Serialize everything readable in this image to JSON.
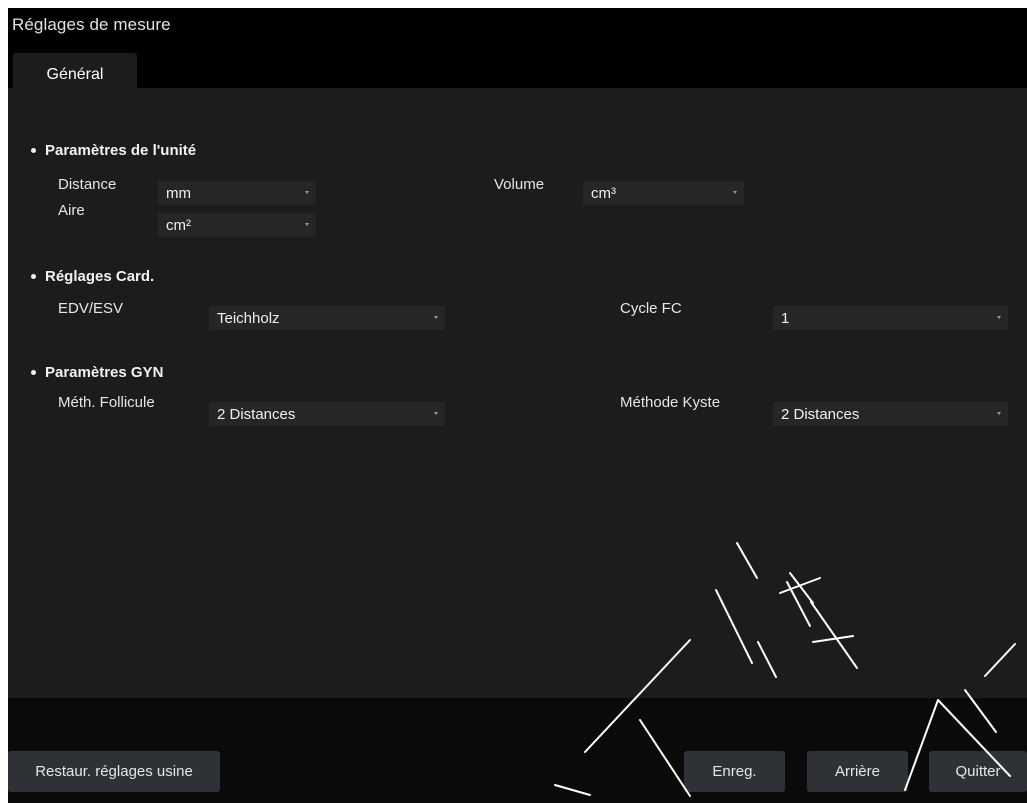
{
  "window": {
    "title": "Réglages de mesure"
  },
  "tabs": [
    {
      "label": "Général",
      "selected": true
    }
  ],
  "sections": {
    "units": {
      "heading": "Paramètres de l'unité",
      "distance": {
        "label": "Distance",
        "value": "mm"
      },
      "area": {
        "label": "Aire",
        "value": "cm²"
      },
      "volume": {
        "label": "Volume",
        "value": "cm³"
      }
    },
    "cardiac": {
      "heading": "Réglages Card.",
      "edv_esv": {
        "label": "EDV/ESV",
        "value": "Teichholz"
      },
      "hr_cycle": {
        "label": "Cycle FC",
        "value": "1"
      }
    },
    "gyn": {
      "heading": "Paramètres GYN",
      "follicle_method": {
        "label": "Méth. Follicule",
        "value": "2 Distances"
      },
      "cyst_method": {
        "label": "Méthode Kyste",
        "value": "2 Distances"
      }
    }
  },
  "buttons": {
    "restore_defaults": "Restaur. réglages usine",
    "save": "Enreg.",
    "back": "Arrière",
    "quit": "Quitter"
  },
  "icons": {
    "bullet": "bullet-icon",
    "dropdown_caret": "chevron-down-icon"
  },
  "colors": {
    "background": "#000000",
    "panel": "#1c1c1e",
    "dropdown": "#262628",
    "button": "#2e3236",
    "text": "#e6e6e6"
  }
}
